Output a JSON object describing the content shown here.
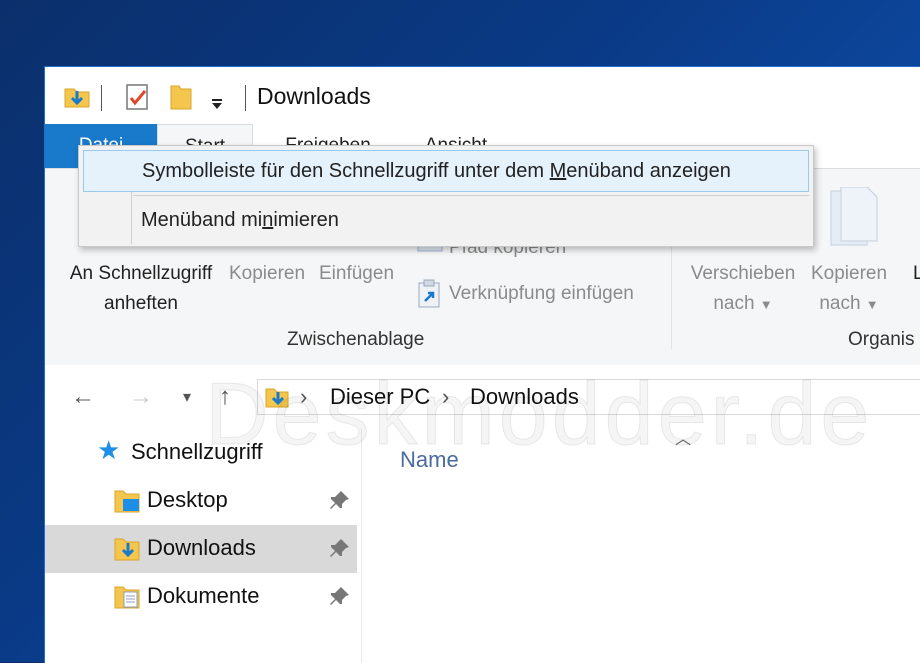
{
  "window": {
    "title": "Downloads",
    "qat": {
      "icons": [
        "folder-download-icon",
        "properties-check-icon",
        "new-folder-icon",
        "qat-dropdown-icon"
      ]
    }
  },
  "tabs": {
    "file": "Datei",
    "start": "Start",
    "share": "Freigeben",
    "view": "Ansicht"
  },
  "ribbon": {
    "pin_line1": "An Schnellzugriff",
    "pin_line2": "anheften",
    "copy": "Kopieren",
    "paste": "Einfügen",
    "copy_path": "Pfad kopieren",
    "paste_shortcut": "Verknüpfung einfügen",
    "move_line1": "Verschieben",
    "move_line2": "nach",
    "copyto_line1": "Kopieren",
    "copyto_line2": "nach",
    "clipboard_group": "Zwischenablage",
    "organize_group": "Organis",
    "cut_letter": "L"
  },
  "context_menu": {
    "item1": {
      "before": "Symbolleiste für den Schnellzugriff unter dem ",
      "accel": "M",
      "after": "enüband anzeigen"
    },
    "item2": {
      "before": "Menüband mi",
      "accel": "n",
      "after": "imieren"
    }
  },
  "address": {
    "crumbs": [
      "Dieser PC",
      "Downloads"
    ]
  },
  "nav": {
    "quick_access": "Schnellzugriff",
    "items": [
      {
        "label": "Desktop",
        "pinned": true
      },
      {
        "label": "Downloads",
        "pinned": true,
        "selected": true
      },
      {
        "label": "Dokumente",
        "pinned": true
      }
    ]
  },
  "content": {
    "column_name": "Name"
  },
  "watermark": "Deskmodder.de",
  "colors": {
    "accent": "#1979ca",
    "selected_row": "#d9d9d9",
    "menu_hover": "#e5f1fb"
  }
}
